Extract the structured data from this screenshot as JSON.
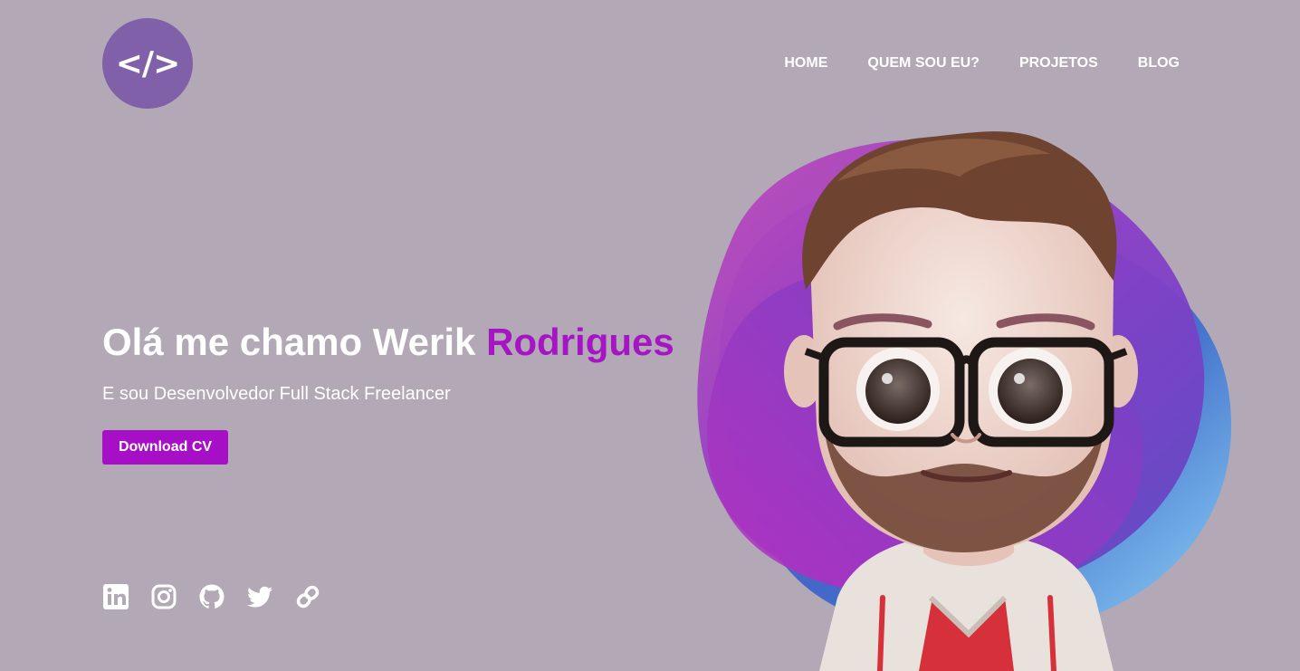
{
  "logo": {
    "symbol": "</>",
    "bg_color": "#8060a8"
  },
  "nav": {
    "items": [
      {
        "label": "HOME"
      },
      {
        "label": "QUEM SOU EU?"
      },
      {
        "label": "PROJETOS"
      },
      {
        "label": "BLOG"
      }
    ]
  },
  "hero": {
    "title_prefix": "Olá me chamo Werik ",
    "title_highlight": "Rodrigues",
    "subtitle": "E sou Desenvolvedor Full Stack Freelancer",
    "button_label": "Download CV",
    "accent_color": "#a70fc6"
  },
  "social": {
    "icons": [
      "linkedin-icon",
      "instagram-icon",
      "github-icon",
      "twitter-icon",
      "link-icon"
    ]
  },
  "colors": {
    "background": "#b2a8b6",
    "text": "#ffffff"
  },
  "illustration": {
    "icon": "cartoon-avatar-with-glasses"
  }
}
